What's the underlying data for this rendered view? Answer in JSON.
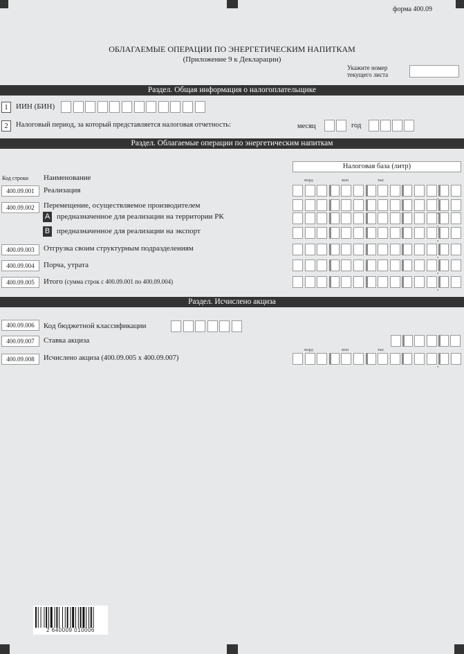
{
  "form_number": "форма 400.09",
  "title": "ОБЛАГАЕМЫЕ ОПЕРАЦИИ ПО ЭНЕРГЕТИЧЕСКИМ НАПИТКАМ",
  "subtitle": "(Приложение 9 к Декларации)",
  "sheet_number_label_1": "Укажите номер",
  "sheet_number_label_2": "текущего листа",
  "sections": {
    "general": "Раздел. Общая информация о налогоплательщике",
    "operations": "Раздел. Облагаемые операции по энергетическим напиткам",
    "excise": "Раздел. Исчислено акциза"
  },
  "general": {
    "row1_num": "1",
    "row1_label": "ИИН (БИН)",
    "row2_num": "2",
    "row2_label": "Налоговый период, за который представляется налоговая отчетность:",
    "month_label": "месяц",
    "year_label": "год"
  },
  "operations": {
    "tax_base_header": "Налоговая база (литр)",
    "col_code": "Код строки",
    "col_name": "Наименование",
    "scale_mlrd": "млрд",
    "scale_mln": "млн",
    "scale_tys": "тыс",
    "rows": [
      {
        "code": "400.09.001",
        "label": "Реализация"
      },
      {
        "code": "400.09.002",
        "label": "Перемещение, осуществляемое производителем"
      },
      {
        "code": "",
        "letter": "A",
        "label": "предназначенное для реализации на территории РК"
      },
      {
        "code": "",
        "letter": "B",
        "label": "предназначенное для реализации на экспорт"
      },
      {
        "code": "400.09.003",
        "label": "Отгрузка своим структурным подразделениям"
      },
      {
        "code": "400.09.004",
        "label": "Порча, утрата"
      },
      {
        "code": "400.09.005",
        "label": "Итого",
        "note": "(сумма строк с 400.09.001 по 400.09.004)"
      }
    ]
  },
  "excise": {
    "rows": [
      {
        "code": "400.09.006",
        "label": "Код бюджетной классификации"
      },
      {
        "code": "400.09.007",
        "label": "Ставка акциза"
      },
      {
        "code": "400.09.008",
        "label": "Исчислено акциза (400.09.005 х 400.09.007)"
      }
    ]
  },
  "barcode_number": "2 640009 010006"
}
